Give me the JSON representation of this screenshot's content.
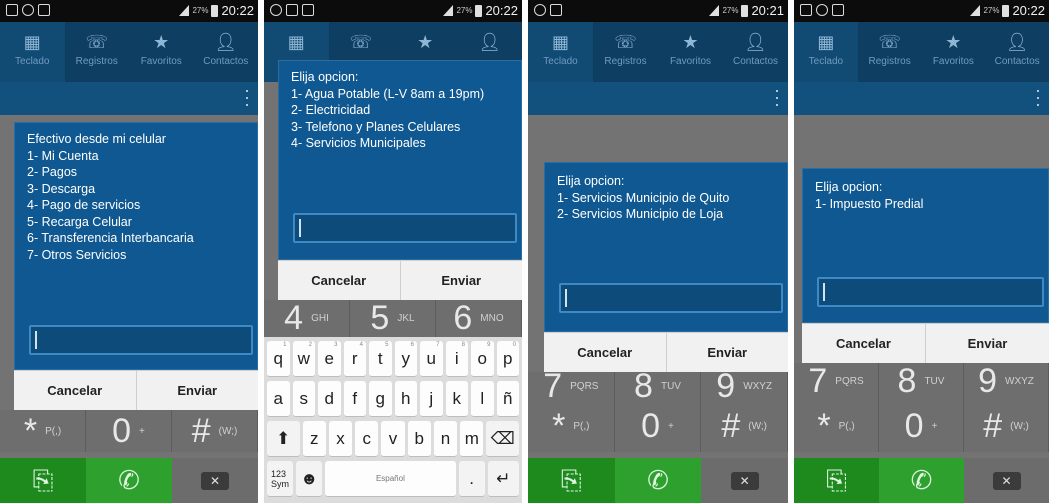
{
  "phones": [
    {
      "statusbar": {
        "battery": "27%",
        "time": "20:22"
      },
      "tabs": [
        "Teclado",
        "Registros",
        "Favoritos",
        "Contactos"
      ],
      "dialog": {
        "lines": [
          "Efectivo desde mi celular",
          "1- Mi Cuenta",
          "2- Pagos",
          "3- Descarga",
          "4- Pago de servicios",
          "5- Recarga Celular",
          "6- Transferencia Interbancaria",
          "7- Otros Servicios"
        ],
        "cancel": "Cancelar",
        "send": "Enviar"
      },
      "dialpad": [
        {
          "digit": "*",
          "letters": "P(,)"
        },
        {
          "digit": "0",
          "letters": "+"
        },
        {
          "digit": "#",
          "letters": "(W;)"
        }
      ]
    },
    {
      "statusbar": {
        "battery": "27%",
        "time": "20:22"
      },
      "dialog": {
        "lines": [
          "Elija opcion:",
          "1- Agua Potable (L-V 8am a 19pm)",
          "2- Electricidad",
          "3- Telefono y Planes Celulares",
          "4- Servicios Municipales"
        ],
        "cancel": "Cancelar",
        "send": "Enviar"
      },
      "dialpad": [
        {
          "digit": "4",
          "letters": "GHI"
        },
        {
          "digit": "5",
          "letters": "JKL"
        },
        {
          "digit": "6",
          "letters": "MNO"
        }
      ],
      "keyboard": {
        "row1": [
          "q",
          "w",
          "e",
          "r",
          "t",
          "y",
          "u",
          "i",
          "o",
          "p"
        ],
        "row1_hints": [
          "1",
          "2",
          "3",
          "4",
          "5",
          "6",
          "7",
          "8",
          "9",
          "0"
        ],
        "row2": [
          "a",
          "s",
          "d",
          "f",
          "g",
          "h",
          "j",
          "k",
          "l",
          "ñ"
        ],
        "row3": [
          "z",
          "x",
          "c",
          "v",
          "b",
          "n",
          "m"
        ],
        "sym": "123\nSym",
        "space": "Español",
        "period": "."
      }
    },
    {
      "statusbar": {
        "battery": "27%",
        "time": "20:21"
      },
      "tabs": [
        "Teclado",
        "Registros",
        "Favoritos",
        "Contactos"
      ],
      "dialog": {
        "lines": [
          "Elija opcion:",
          "1- Servicios Municipio de Quito",
          "2- Servicios Municipio de Loja"
        ],
        "cancel": "Cancelar",
        "send": "Enviar"
      },
      "dialpad": [
        {
          "digit": "7",
          "letters": "PQRS"
        },
        {
          "digit": "8",
          "letters": "TUV"
        },
        {
          "digit": "9",
          "letters": "WXYZ"
        },
        {
          "digit": "*",
          "letters": "P(,)"
        },
        {
          "digit": "0",
          "letters": "+"
        },
        {
          "digit": "#",
          "letters": "(W;)"
        }
      ]
    },
    {
      "statusbar": {
        "battery": "27%",
        "time": "20:22"
      },
      "tabs": [
        "Teclado",
        "Registros",
        "Favoritos",
        "Contactos"
      ],
      "dialog": {
        "lines": [
          "Elija opcion:",
          "1- Impuesto Predial"
        ],
        "cancel": "Cancelar",
        "send": "Enviar"
      },
      "dialpad": [
        {
          "digit": "7",
          "letters": "PQRS"
        },
        {
          "digit": "8",
          "letters": "TUV"
        },
        {
          "digit": "9",
          "letters": "WXYZ"
        },
        {
          "digit": "*",
          "letters": "P(,)"
        },
        {
          "digit": "0",
          "letters": "+"
        },
        {
          "digit": "#",
          "letters": "(W;)"
        }
      ]
    }
  ],
  "icons": {
    "tab_icons": [
      "dialpad-grid-icon",
      "call-log-icon",
      "star-icon",
      "person-icon"
    ],
    "call_row": [
      "contact-card-icon",
      "phone-handset-icon",
      "backspace-icon"
    ]
  },
  "colors": {
    "tab_bar": "#0e3f63",
    "dialog": "#0f5891",
    "call_green": "#2ea02e"
  }
}
